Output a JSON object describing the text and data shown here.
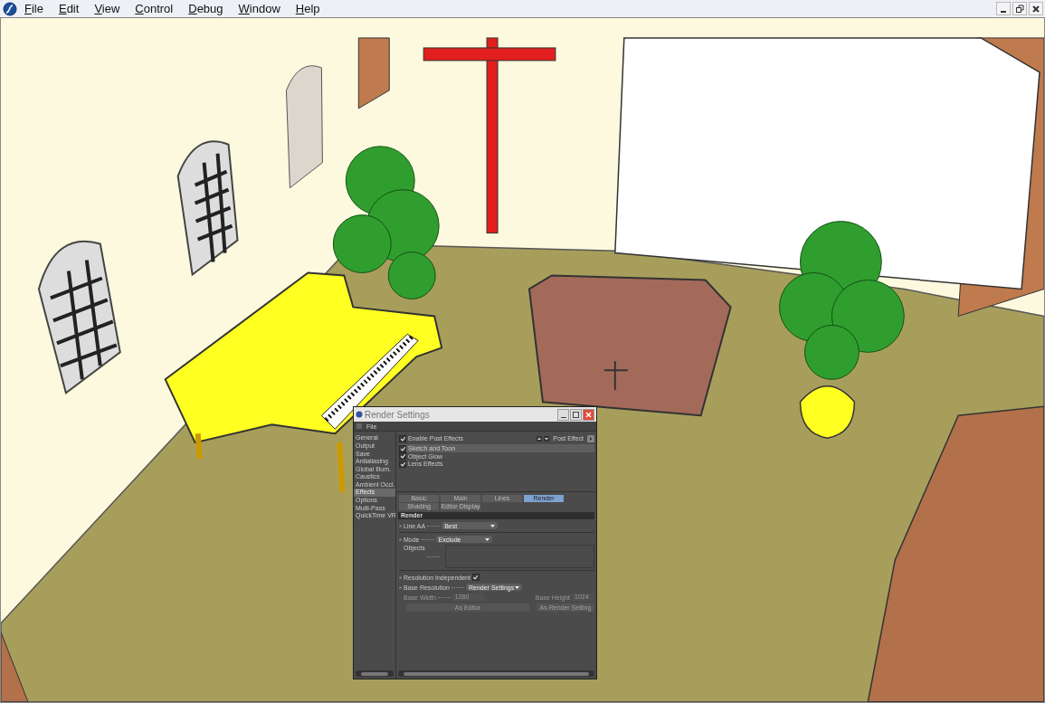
{
  "window": {
    "menu": [
      "File",
      "Edit",
      "View",
      "Control",
      "Debug",
      "Window",
      "Help"
    ]
  },
  "dialog": {
    "title": "Render Settings",
    "menu": [
      "File"
    ],
    "sidebar": [
      {
        "label": "General",
        "selected": false
      },
      {
        "label": "Output",
        "selected": false
      },
      {
        "label": "Save",
        "selected": false
      },
      {
        "label": "Antialiasing",
        "selected": false
      },
      {
        "label": "Global Illum.",
        "selected": false
      },
      {
        "label": "Caustics",
        "selected": false
      },
      {
        "label": "Ambient Occl.",
        "selected": false
      },
      {
        "label": "Effects",
        "selected": true
      },
      {
        "label": "Options",
        "selected": false
      },
      {
        "label": "Multi-Pass",
        "selected": false
      },
      {
        "label": "QuickTime VR",
        "selected": false
      }
    ],
    "enable_post_effects": {
      "label": "Enable Post Effects",
      "checked": true
    },
    "post_effect_label": "Post Effect",
    "effects": [
      {
        "label": "Sketch and Toon",
        "checked": true,
        "selected": true
      },
      {
        "label": "Object Glow",
        "checked": true,
        "selected": false
      },
      {
        "label": "Lens Effects",
        "checked": true,
        "selected": false
      }
    ],
    "tabs": [
      {
        "label": "Basic",
        "selected": false
      },
      {
        "label": "Main",
        "selected": false
      },
      {
        "label": "Lines",
        "selected": false
      },
      {
        "label": "Render",
        "selected": true
      },
      {
        "label": "Shading",
        "selected": false
      },
      {
        "label": "Editor Display",
        "selected": false
      }
    ],
    "section_title": "Render",
    "rows": [
      {
        "kind": "dropdown",
        "label": "Line AA",
        "value": "Best",
        "disabled": false
      },
      {
        "kind": "divider"
      },
      {
        "kind": "dropdown",
        "label": "Mode",
        "value": "Exclude",
        "disabled": false
      },
      {
        "kind": "list",
        "label": "Objects"
      },
      {
        "kind": "divider"
      },
      {
        "kind": "checkbox",
        "label": "Resolution Independent",
        "checked": true
      },
      {
        "kind": "dropdown",
        "label": "Base Resolution",
        "value": "Render Settings",
        "disabled": false
      },
      {
        "kind": "pair",
        "label": "Base Width",
        "value": "1280",
        "label2": "Base Height",
        "value2": "1024",
        "disabled": true
      },
      {
        "kind": "buttons",
        "labels": [
          "As Editor",
          "As Render Setting"
        ],
        "disabled": true
      }
    ]
  }
}
